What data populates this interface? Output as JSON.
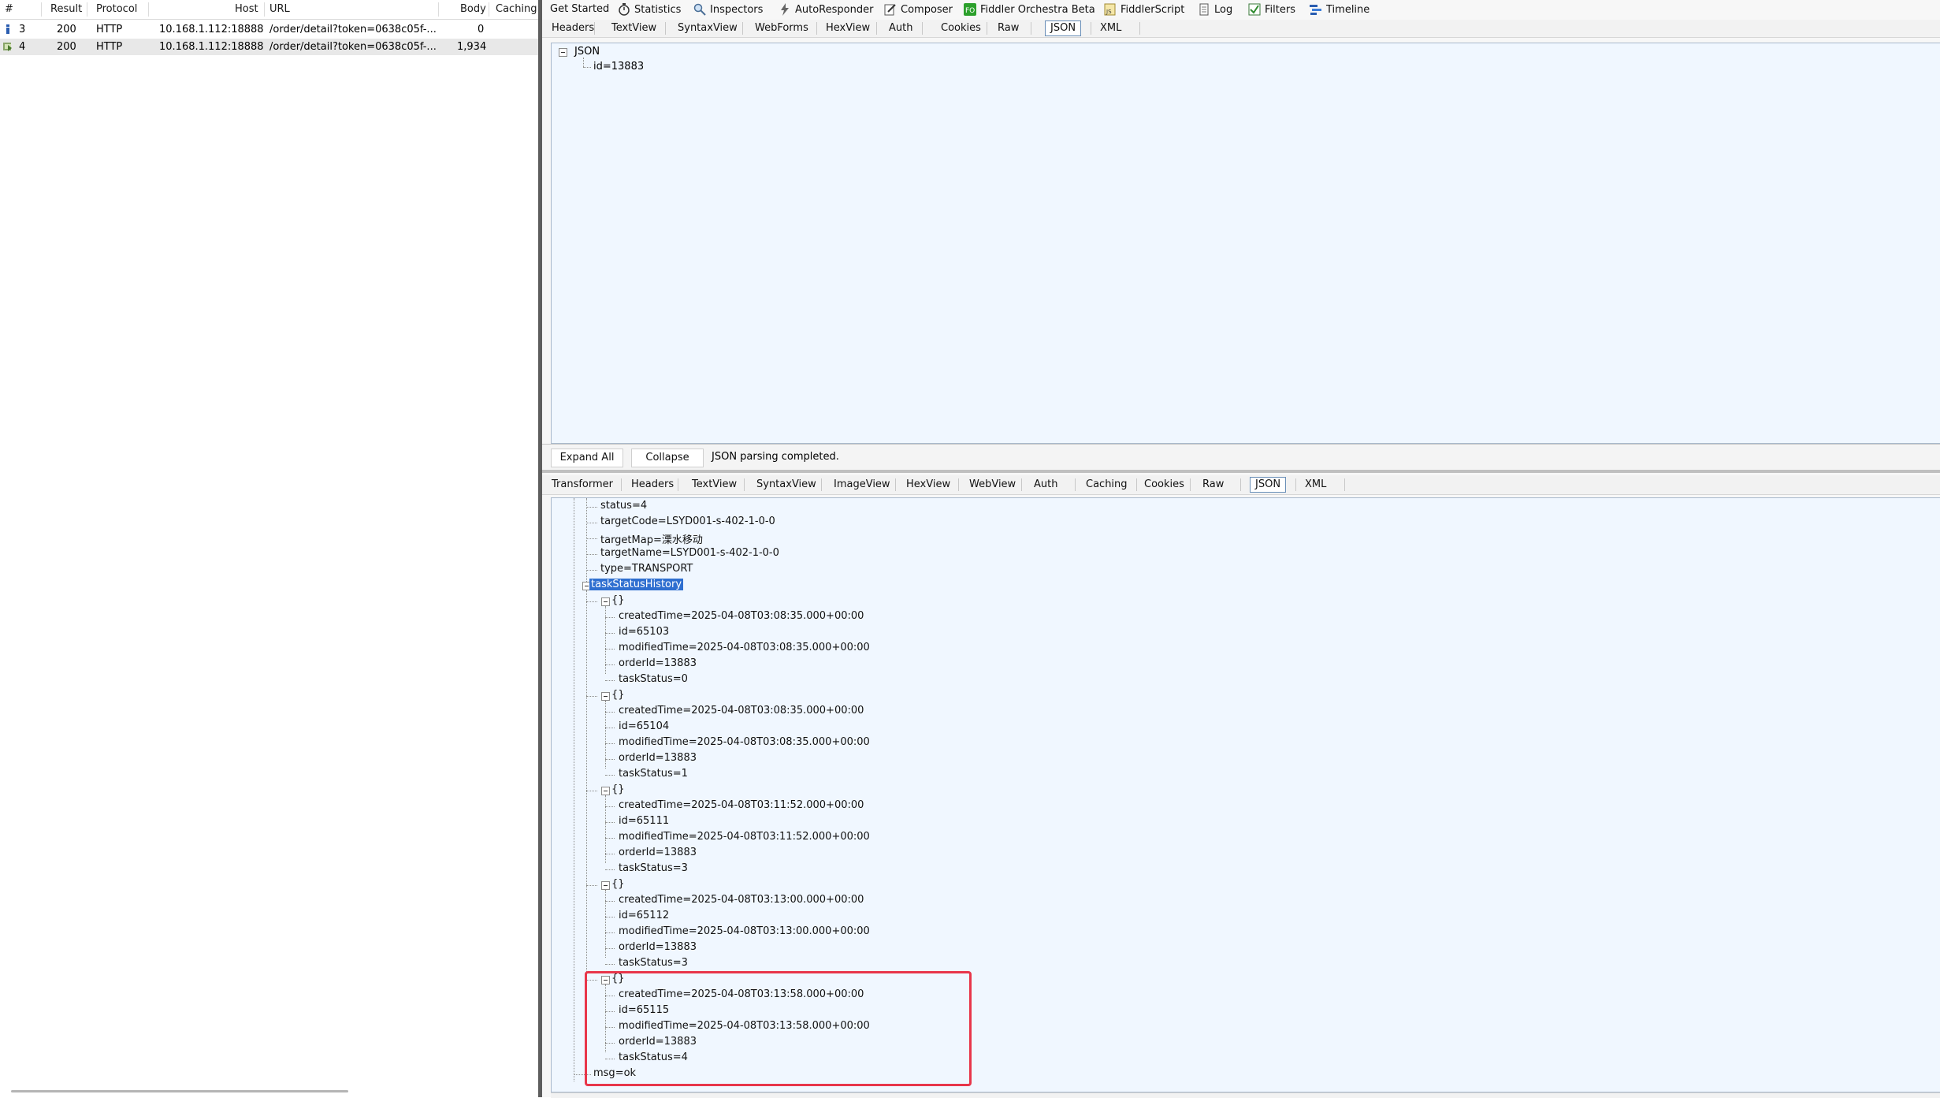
{
  "session_list": {
    "columns": [
      "#",
      "Result",
      "Protocol",
      "Host",
      "URL",
      "Body",
      "Caching"
    ],
    "rows": [
      {
        "num": "3",
        "result": "200",
        "protocol": "HTTP",
        "host": "10.168.1.112:18888",
        "url": "/order/detail?token=0638c05f-...",
        "body": "0",
        "caching": ""
      },
      {
        "num": "4",
        "result": "200",
        "protocol": "HTTP",
        "host": "10.168.1.112:18888",
        "url": "/order/detail?token=0638c05f-...",
        "body": "1,934",
        "caching": ""
      }
    ]
  },
  "main_tabs": [
    "Get Started",
    "Statistics",
    "Inspectors",
    "AutoResponder",
    "Composer",
    "Fiddler Orchestra Beta",
    "FiddlerScript",
    "Log",
    "Filters",
    "Timeline"
  ],
  "request_tabs": [
    "Headers",
    "TextView",
    "SyntaxView",
    "WebForms",
    "HexView",
    "Auth",
    "Cookies",
    "Raw",
    "JSON",
    "XML"
  ],
  "request_active_tab": "JSON",
  "request_tree": {
    "root": "JSON",
    "child": "id=13883"
  },
  "toolbar": {
    "expand_all": "Expand All",
    "collapse": "Collapse",
    "status": "JSON parsing completed."
  },
  "response_tabs": [
    "Transformer",
    "Headers",
    "TextView",
    "SyntaxView",
    "ImageView",
    "HexView",
    "WebView",
    "Auth",
    "Caching",
    "Cookies",
    "Raw",
    "JSON",
    "XML"
  ],
  "response_active_tab": "JSON",
  "response_tree": {
    "top_items": [
      "status=4",
      "targetCode=LSYD001-s-402-1-0-0",
      "targetMap=溧水移动",
      "targetName=LSYD001-s-402-1-0-0",
      "type=TRANSPORT"
    ],
    "history_label": "taskStatusHistory",
    "object_label": "{}",
    "entries": [
      [
        "createdTime=2025-04-08T03:08:35.000+00:00",
        "id=65103",
        "modifiedTime=2025-04-08T03:08:35.000+00:00",
        "orderId=13883",
        "taskStatus=0"
      ],
      [
        "createdTime=2025-04-08T03:08:35.000+00:00",
        "id=65104",
        "modifiedTime=2025-04-08T03:08:35.000+00:00",
        "orderId=13883",
        "taskStatus=1"
      ],
      [
        "createdTime=2025-04-08T03:11:52.000+00:00",
        "id=65111",
        "modifiedTime=2025-04-08T03:11:52.000+00:00",
        "orderId=13883",
        "taskStatus=3"
      ],
      [
        "createdTime=2025-04-08T03:13:00.000+00:00",
        "id=65112",
        "modifiedTime=2025-04-08T03:13:00.000+00:00",
        "orderId=13883",
        "taskStatus=3"
      ],
      [
        "createdTime=2025-04-08T03:13:58.000+00:00",
        "id=65115",
        "modifiedTime=2025-04-08T03:13:58.000+00:00",
        "orderId=13883",
        "taskStatus=4"
      ]
    ],
    "msg": "msg=ok"
  },
  "colors": {
    "highlight": "#e8364a",
    "selection": "#2f6fd0",
    "pane_bg": "#f0f7ff"
  }
}
